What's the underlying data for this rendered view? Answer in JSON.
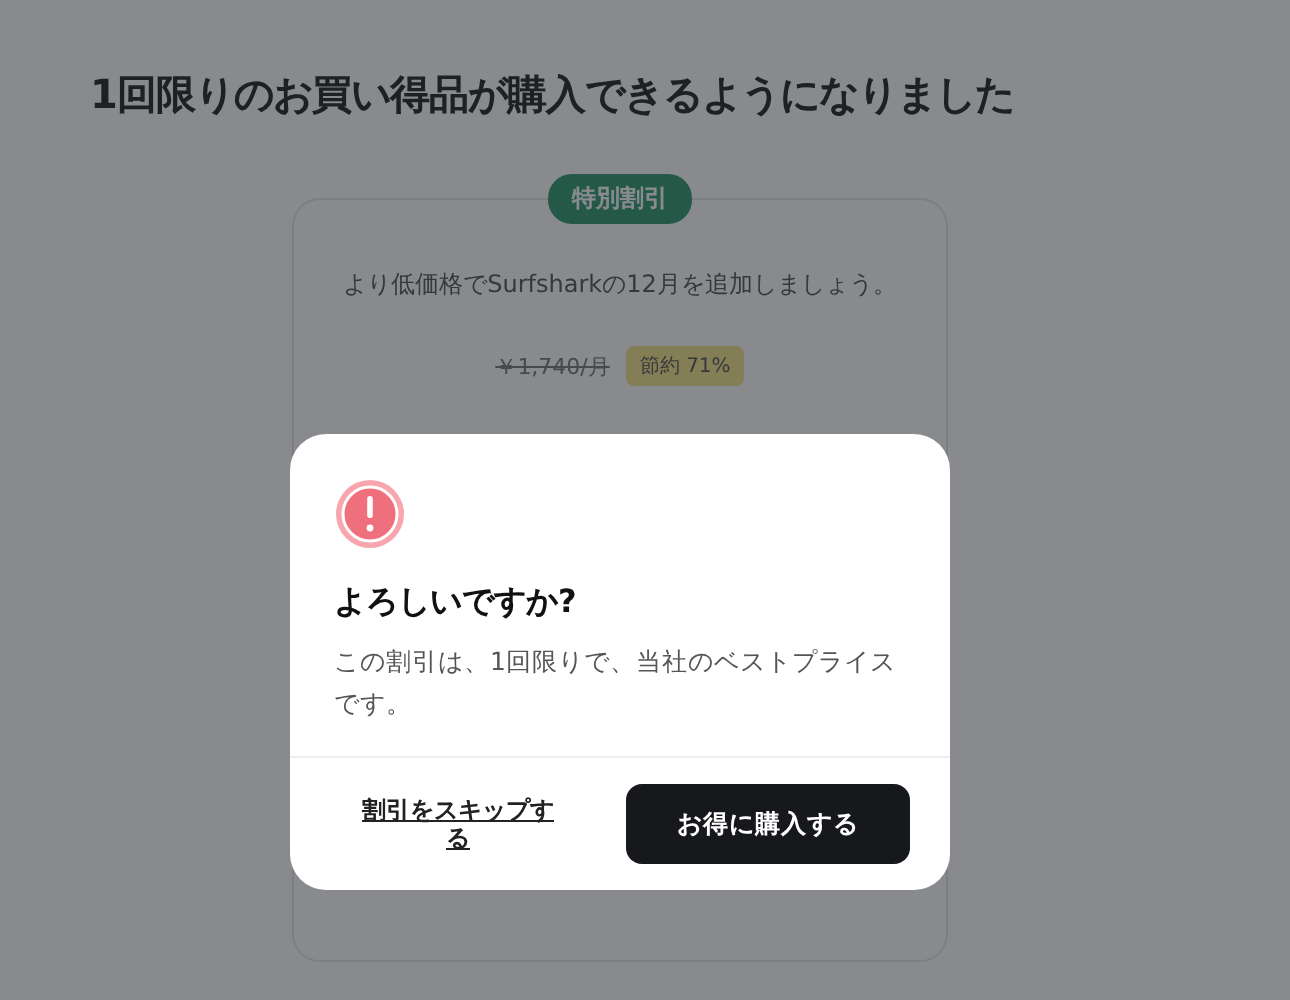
{
  "page": {
    "title": "1回限りのお買い得品が購入できるようになりました"
  },
  "offer": {
    "badge": "特別割引",
    "description": "より低価格でSurfsharkの12月を追加しましょう。",
    "old_price": "￥1,740/月",
    "saving": "節約 71%"
  },
  "dialog": {
    "title": "よろしいですか?",
    "message": "この割引は、1回限りで、当社のベストプライスです。",
    "buttons": [
      {
        "label": "割引をスキップする",
        "kind": "link"
      },
      {
        "label": "お得に購入する",
        "kind": "primary"
      }
    ]
  }
}
